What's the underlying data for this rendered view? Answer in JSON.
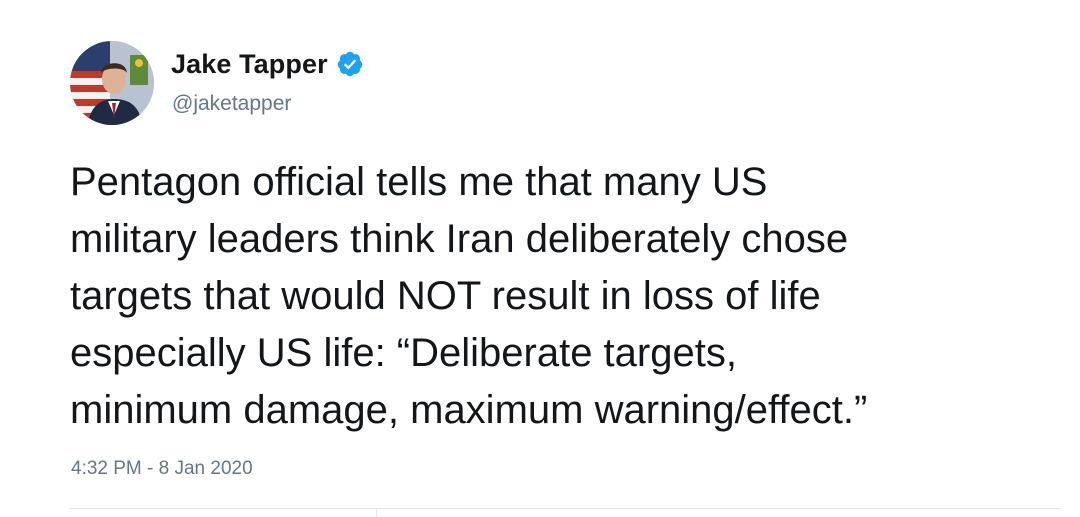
{
  "author": {
    "name": "Jake Tapper",
    "handle": "@jaketapper",
    "verified": true
  },
  "tweet": {
    "lines": [
      "Pentagon official tells me that many US",
      "military leaders think Iran deliberately chose",
      "targets that would NOT result in loss of life",
      "especially US life: “Deliberate targets,",
      "minimum damage, maximum warning/effect.”"
    ],
    "timestamp": "4:32 PM - 8 Jan 2020"
  },
  "icons": {
    "verified": "verified-badge-icon",
    "avatar": "profile-photo"
  },
  "colors": {
    "verified_blue": "#1da1f2",
    "text_primary": "#14171a",
    "text_secondary": "#657786",
    "divider": "#e1e8ed"
  }
}
